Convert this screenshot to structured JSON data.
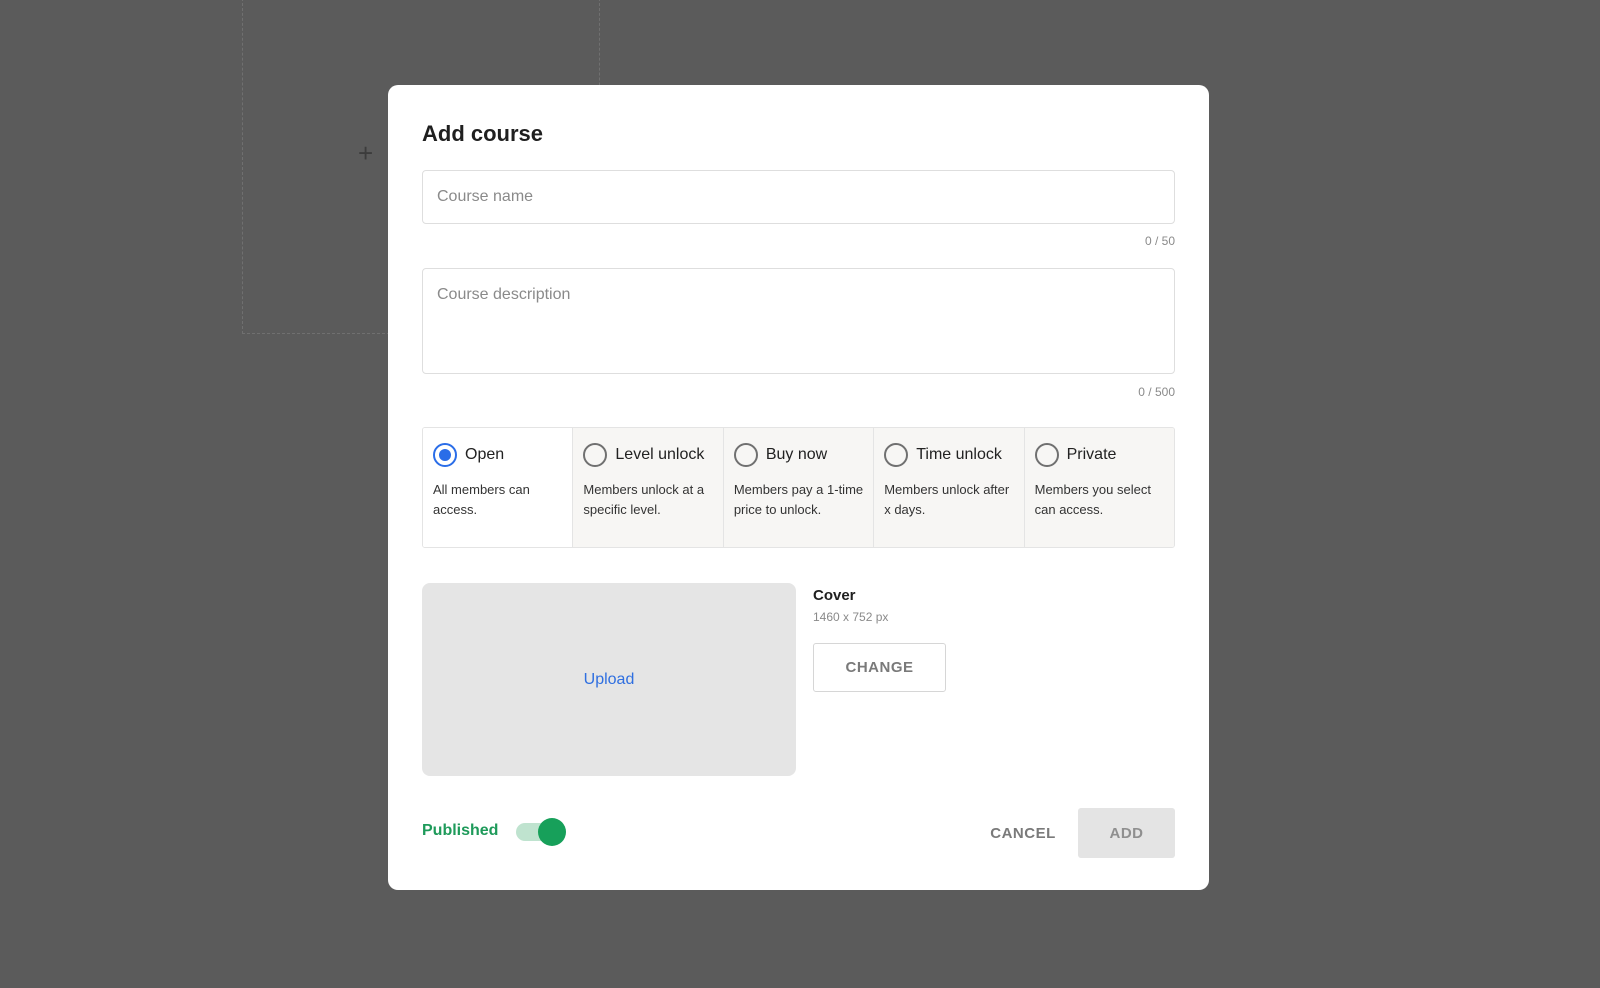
{
  "background": {
    "plus_icon": "+"
  },
  "modal": {
    "title": "Add course",
    "course_name": {
      "value": "",
      "placeholder": "Course name",
      "counter": "0 / 50"
    },
    "course_description": {
      "value": "",
      "placeholder": "Course description",
      "counter": "0 / 500"
    },
    "access_options": [
      {
        "label": "Open",
        "description": "All members can access.",
        "selected": true
      },
      {
        "label": "Level unlock",
        "description": "Members unlock at a specific level.",
        "selected": false
      },
      {
        "label": "Buy now",
        "description": "Members pay a 1-time price to unlock.",
        "selected": false
      },
      {
        "label": "Time unlock",
        "description": "Members unlock after x days.",
        "selected": false
      },
      {
        "label": "Private",
        "description": "Members you select can access.",
        "selected": false
      }
    ],
    "cover": {
      "upload_label": "Upload",
      "title": "Cover",
      "size": "1460 x 752 px",
      "change_label": "CHANGE"
    },
    "footer": {
      "published_label": "Published",
      "published_on": true,
      "cancel_label": "CANCEL",
      "add_label": "ADD"
    }
  },
  "colors": {
    "accent_blue": "#2a6de8",
    "published_green": "#17a05a",
    "overlay": "#5b5b5b"
  }
}
